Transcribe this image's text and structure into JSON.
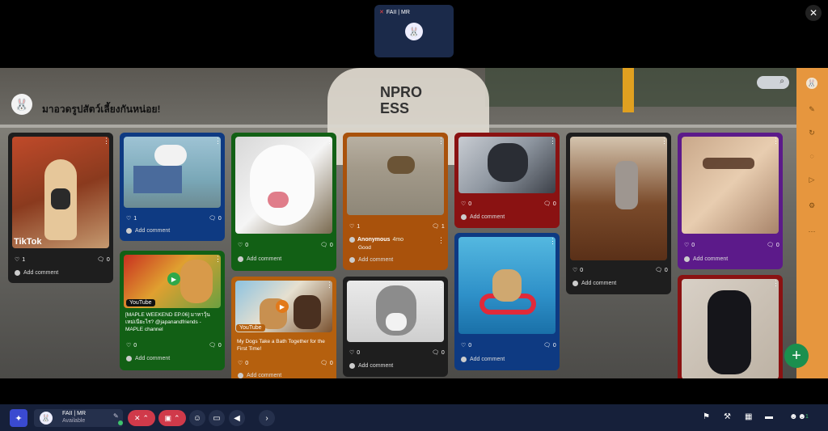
{
  "presenter": {
    "label": "FAII | MR",
    "avatar_icon": "bunny-avatar-icon"
  },
  "board": {
    "title": "มาอวดรูปสัตว์เลี้ยงกันหน่อย!"
  },
  "cards": {
    "c1": {
      "badge": "TikTok",
      "likes": "1",
      "comments": "0",
      "add": "Add comment",
      "color": "#1e1e1e"
    },
    "c2": {
      "likes": "1",
      "comments": "0",
      "add": "Add comment",
      "color": "#0e3a82"
    },
    "c3": {
      "likes": "0",
      "comments": "0",
      "add": "Add comment",
      "color": "#126015"
    },
    "c4": {
      "likes": "1",
      "comments": "1",
      "author": "Anonymous",
      "time": "4mo",
      "comment": "Good",
      "add": "Add comment",
      "color": "#a9520c"
    },
    "c5": {
      "likes": "0",
      "comments": "0",
      "add": "Add comment",
      "color": "#8a1212"
    },
    "c6": {
      "likes": "0",
      "comments": "0",
      "add": "Add comment",
      "color": "#1e1e1e"
    },
    "c7": {
      "likes": "0",
      "comments": "0",
      "add": "Add comment",
      "color": "#5c1a8a"
    },
    "c8": {
      "badge": "YouTube",
      "text": "[MAPLE WEEKEND EP.06] มาหาวุ้นเหม่เนียะไร? @japanandfriends - MAPLE channel",
      "likes": "0",
      "comments": "0",
      "add": "Add comment",
      "color": "#126015"
    },
    "c9": {
      "badge": "YouTube",
      "text": "My Dogs Take a Bath Together for the First Time!",
      "likes": "0",
      "comments": "0",
      "add": "Add comment",
      "color": "#b5600e"
    },
    "c10": {
      "likes": "0",
      "comments": "0",
      "add": "Add comment",
      "color": "#1e1e1e"
    },
    "c11": {
      "likes": "0",
      "comments": "0",
      "add": "Add comment",
      "color": "#0e3a82"
    },
    "c12": {
      "color": "#8a1212"
    }
  },
  "bottom": {
    "user_name": "FAII | MR",
    "user_status": "Available",
    "participants": "1"
  }
}
